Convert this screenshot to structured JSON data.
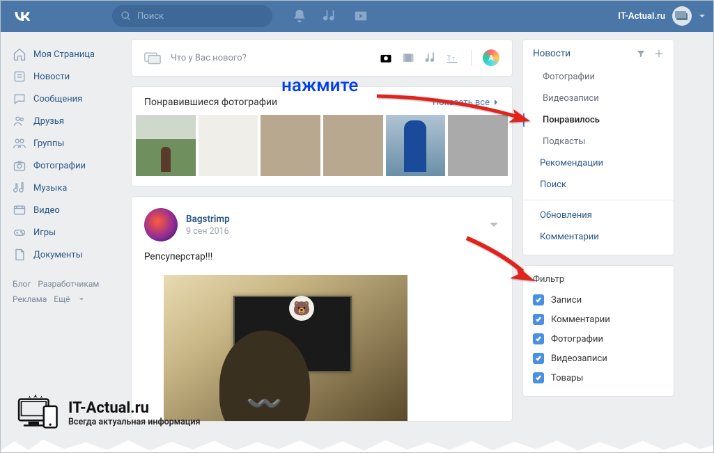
{
  "header": {
    "search_placeholder": "Поиск",
    "username": "IT-Actual.ru"
  },
  "left_nav": [
    "Моя Страница",
    "Новости",
    "Сообщения",
    "Друзья",
    "Группы",
    "Фотографии",
    "Музыка",
    "Видео",
    "Игры",
    "Документы"
  ],
  "footer": {
    "blog": "Блог",
    "devs": "Разработчикам",
    "ads": "Реклама",
    "more": "Ещё"
  },
  "composer": {
    "placeholder": "Что у Вас нового?"
  },
  "liked_photos": {
    "title": "Понравившиеся фотографии",
    "show_all": "Показать все"
  },
  "post": {
    "user": "Bagstrimp",
    "date": "9 сен 2016",
    "text": "Репсуперстар!!!"
  },
  "right": {
    "news_header": "Новости",
    "items_top": [
      "Фотографии",
      "Видеозаписи",
      "Понравилось",
      "Подкасты"
    ],
    "items_mid": [
      "Рекомендации",
      "Поиск"
    ],
    "items_bot": [
      "Обновления",
      "Комментарии"
    ],
    "filter_title": "Фильтр",
    "filters": [
      "Записи",
      "Комментарии",
      "Фотографии",
      "Видеозаписи",
      "Товары"
    ]
  },
  "annotation": {
    "press": "нажмите"
  },
  "watermark": {
    "title": "IT-Actual.ru",
    "subtitle": "Всегда актуальная информация"
  }
}
